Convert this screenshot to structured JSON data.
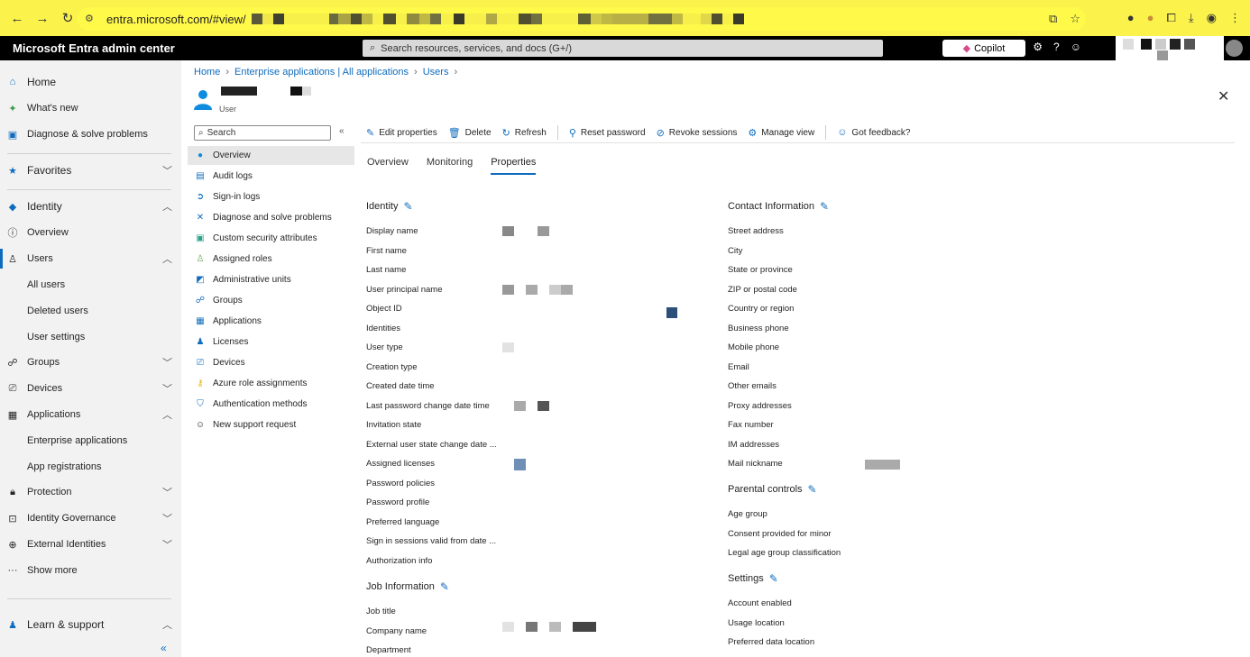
{
  "browser": {
    "url": "entra.microsoft.com/#view/",
    "back_icon": "arrow-left-icon",
    "forward_icon": "arrow-right-icon",
    "reload_icon": "reload-icon"
  },
  "portal": {
    "brand": "Microsoft Entra admin center",
    "search_placeholder": "Search resources, services, and docs (G+/)",
    "copilot_label": "Copilot"
  },
  "leftnav": {
    "home": "Home",
    "whats_new": "What's new",
    "diagnose": "Diagnose & solve problems",
    "favorites": "Favorites",
    "identity": "Identity",
    "overview": "Overview",
    "users": "Users",
    "all_users": "All users",
    "deleted_users": "Deleted users",
    "user_settings": "User settings",
    "groups": "Groups",
    "devices": "Devices",
    "applications": "Applications",
    "enterprise_apps": "Enterprise applications",
    "app_registrations": "App registrations",
    "protection": "Protection",
    "identity_governance": "Identity Governance",
    "external_identities": "External Identities",
    "show_more": "Show more",
    "learn_support": "Learn & support",
    "collapse": "«"
  },
  "breadcrumb": {
    "home": "Home",
    "enterprise": "Enterprise applications | All applications",
    "users": "Users"
  },
  "user_header": {
    "subtitle": "User"
  },
  "subnav": {
    "search_placeholder": "Search",
    "collapse": "«",
    "items": [
      "Overview",
      "Audit logs",
      "Sign-in logs",
      "Diagnose and solve problems",
      "Custom security attributes",
      "Assigned roles",
      "Administrative units",
      "Groups",
      "Applications",
      "Licenses",
      "Devices",
      "Azure role assignments",
      "Authentication methods",
      "New support request"
    ]
  },
  "toolbar": {
    "edit": "Edit properties",
    "delete": "Delete",
    "refresh": "Refresh",
    "reset_password": "Reset password",
    "revoke": "Revoke sessions",
    "manage_view": "Manage view",
    "feedback": "Got feedback?"
  },
  "tabs": [
    "Overview",
    "Monitoring",
    "Properties"
  ],
  "properties": {
    "identity_title": "Identity",
    "identity": [
      "Display name",
      "First name",
      "Last name",
      "User principal name",
      "Object ID",
      "Identities",
      "User type",
      "Creation type",
      "Created date time",
      "Last password change date time",
      "Invitation state",
      "External user state change date ...",
      "Assigned licenses",
      "Password policies",
      "Password profile",
      "Preferred language",
      "Sign in sessions valid from date ...",
      "Authorization info"
    ],
    "job_title": "Job Information",
    "job": [
      "Job title",
      "Company name",
      "Department"
    ],
    "contact_title": "Contact Information",
    "contact": [
      "Street address",
      "City",
      "State or province",
      "ZIP or postal code",
      "Country or region",
      "Business phone",
      "Mobile phone",
      "Email",
      "Other emails",
      "Proxy addresses",
      "Fax number",
      "IM addresses",
      "Mail nickname"
    ],
    "parental_title": "Parental controls",
    "parental": [
      "Age group",
      "Consent provided for minor",
      "Legal age group classification"
    ],
    "settings_title": "Settings",
    "settings": [
      "Account enabled",
      "Usage location",
      "Preferred data location"
    ]
  },
  "colors": {
    "accent": "#0f6cbd",
    "browser_bar": "#fbf34c",
    "topbar": "#000000"
  }
}
